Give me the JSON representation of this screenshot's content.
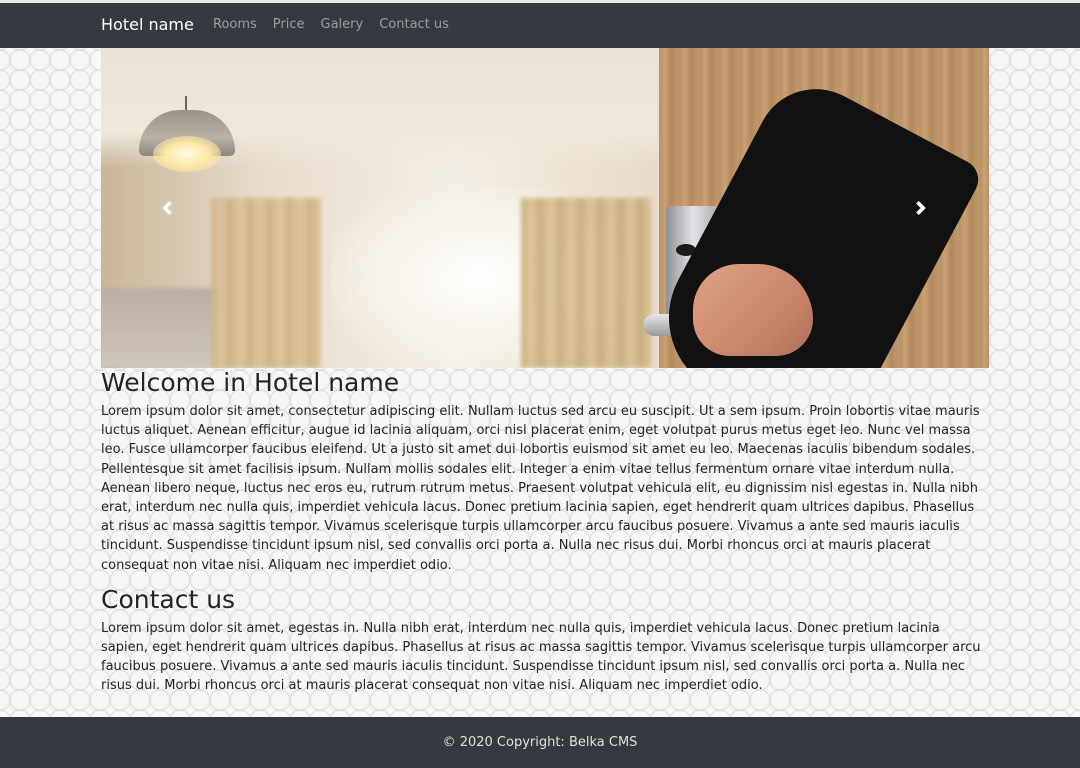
{
  "navbar": {
    "brand": "Hotel name",
    "links": [
      "Rooms",
      "Price",
      "Galery",
      "Contact us"
    ]
  },
  "carousel": {
    "prev_icon": "chevron-left-icon",
    "next_icon": "chevron-right-icon"
  },
  "welcome": {
    "title": "Welcome in Hotel name",
    "text": "Lorem ipsum dolor sit amet, consectetur adipiscing elit. Nullam luctus sed arcu eu suscipit. Ut a sem ipsum. Proin lobortis vitae mauris luctus aliquet. Aenean efficitur, augue id lacinia aliquam, orci nisl placerat enim, eget volutpat purus metus eget leo. Nunc vel massa leo. Fusce ullamcorper faucibus eleifend. Ut a justo sit amet dui lobortis euismod sit amet eu leo. Maecenas iaculis bibendum sodales. Pellentesque sit amet facilisis ipsum. Nullam mollis sodales elit. Integer a enim vitae tellus fermentum ornare vitae interdum nulla. Aenean libero neque, luctus nec eros eu, rutrum rutrum metus. Praesent volutpat vehicula elit, eu dignissim nisl egestas in. Nulla nibh erat, interdum nec nulla quis, imperdiet vehicula lacus. Donec pretium lacinia sapien, eget hendrerit quam ultrices dapibus. Phasellus at risus ac massa sagittis tempor. Vivamus scelerisque turpis ullamcorper arcu faucibus posuere. Vivamus a ante sed mauris iaculis tincidunt. Suspendisse tincidunt ipsum nisl, sed convallis orci porta a. Nulla nec risus dui. Morbi rhoncus orci at mauris placerat consequat non vitae nisi. Aliquam nec imperdiet odio."
  },
  "contact": {
    "title": "Contact us",
    "text": "Lorem ipsum dolor sit amet, egestas in. Nulla nibh erat, interdum nec nulla quis, imperdiet vehicula lacus. Donec pretium lacinia sapien, eget hendrerit quam ultrices dapibus. Phasellus at risus ac massa sagittis tempor. Vivamus scelerisque turpis ullamcorper arcu faucibus posuere. Vivamus a ante sed mauris iaculis tincidunt. Suspendisse tincidunt ipsum nisl, sed convallis orci porta a. Nulla nec risus dui. Morbi rhoncus orci at mauris placerat consequat non vitae nisi. Aliquam nec imperdiet odio."
  },
  "footer": {
    "copyright": "© 2020 Copyright: Belka CMS"
  },
  "colors": {
    "navbar_bg": "#343a40",
    "footer_bg": "#343a40",
    "nav_link": "rgba(255,255,255,0.5)"
  }
}
